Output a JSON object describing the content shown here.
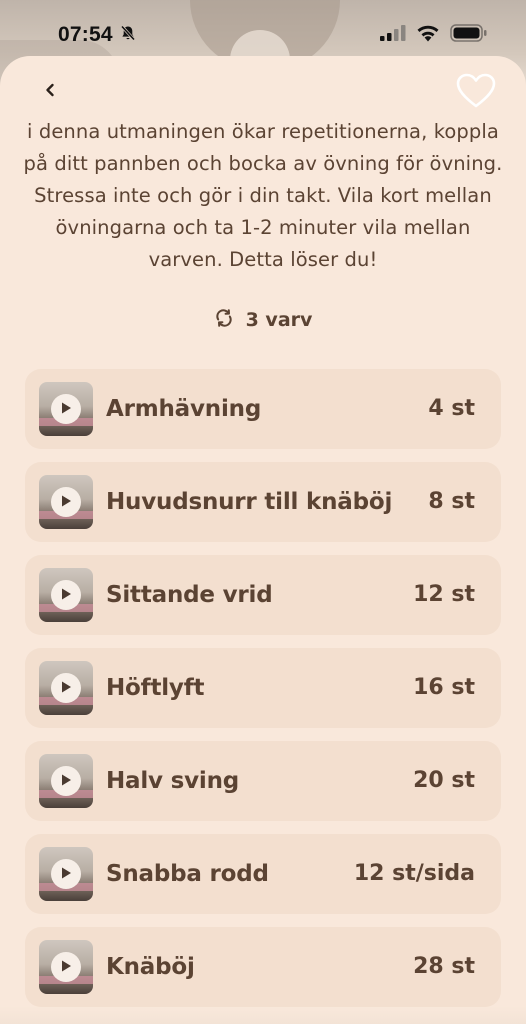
{
  "status_bar": {
    "time": "07:54",
    "bell_icon": "bell-slash-icon",
    "signal_icon": "cellular-signal-icon",
    "wifi_icon": "wifi-icon",
    "battery_icon": "battery-icon"
  },
  "nav": {
    "back_icon": "chevron-left-icon",
    "favorite_icon": "heart-outline-icon"
  },
  "workout": {
    "description": "i denna utmaningen ökar repetitionerna, koppla på ditt pannben och bocka av övning för övning. Stressa inte och gör i din takt. Vila kort mellan övningarna och ta 1-2 minuter vila mellan varven. Detta löser du!",
    "rounds_icon": "repeat-icon",
    "rounds_label": "3 varv"
  },
  "exercises": [
    {
      "name": "Armhävning",
      "reps": "4 st",
      "icon": "play-icon"
    },
    {
      "name": "Huvudsnurr till knäböj",
      "reps": "8 st",
      "icon": "play-icon"
    },
    {
      "name": "Sittande vrid",
      "reps": "12 st",
      "icon": "play-icon"
    },
    {
      "name": "Höftlyft",
      "reps": "16 st",
      "icon": "play-icon"
    },
    {
      "name": "Halv sving",
      "reps": "20 st",
      "icon": "play-icon"
    },
    {
      "name": "Snabba rodd",
      "reps": "12 st/sida",
      "icon": "play-icon"
    },
    {
      "name": "Knäböj",
      "reps": "28 st",
      "icon": "play-icon"
    }
  ],
  "colors": {
    "sheet_background": "#f9e8db",
    "row_background": "#f3dfcf",
    "text_brown": "#5b4333"
  }
}
